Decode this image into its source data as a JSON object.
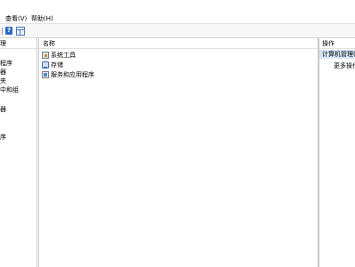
{
  "menubar": {
    "items": [
      {
        "label": "查看(V)"
      },
      {
        "label": "帮助(H)"
      }
    ]
  },
  "toolbar": {
    "buttons": [
      {
        "icon": "help-icon",
        "glyph": "?"
      },
      {
        "icon": "show-hide-pane-icon"
      }
    ]
  },
  "left_pane": {
    "header": "",
    "items": [
      "理",
      "程序",
      "器",
      "夹",
      "中和组",
      "器",
      "",
      "序"
    ]
  },
  "middle_pane": {
    "column_header": "名称",
    "rows": [
      {
        "label": "系统工具",
        "icon": "system-tools-icon"
      },
      {
        "label": "存储",
        "icon": "storage-icon"
      },
      {
        "label": "服务和应用程序",
        "icon": "services-apps-icon"
      }
    ]
  },
  "right_pane": {
    "header": "操作",
    "selected": "计算机管理(本",
    "more": "更多操作"
  }
}
